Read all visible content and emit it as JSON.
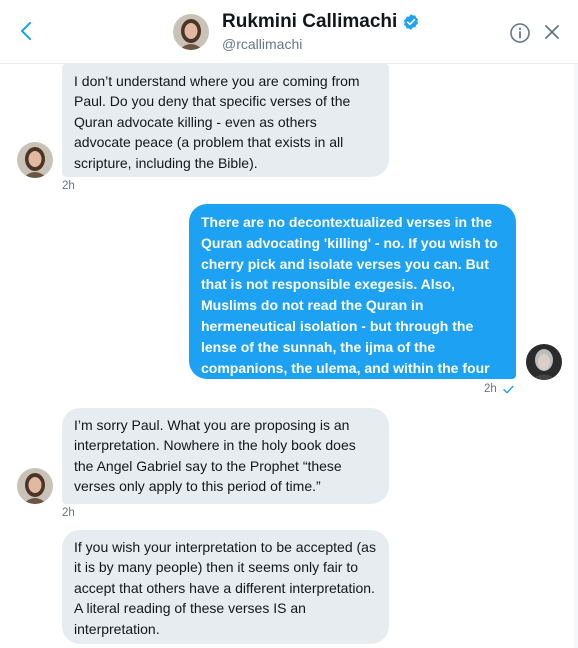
{
  "header": {
    "name": "Rukmini Callimachi",
    "handle": "@rcallimachi"
  },
  "messages": [
    {
      "direction": "incoming",
      "text": "I don’t understand where you are coming from Paul. Do you deny that specific verses of the Quran advocate killing - even as others advocate peace (a problem that exists in all scripture, including the Bible).",
      "time": "2h"
    },
    {
      "direction": "outgoing",
      "text": "There are no decontextualized verses in the Quran advocating 'killing' - no. If you wish to cherry pick and isolate verses you can. But that is not responsible exegesis. Also, Muslims do not read the Quran in hermeneutical isolation - but through the lense of the sunnah, the ijma of the companions, the ulema, and within the four schools.",
      "time": "2h"
    },
    {
      "direction": "incoming",
      "text": "I’m sorry Paul. What you are proposing is an interpretation. Nowhere in the holy book does the Angel Gabriel say to the Prophet “these verses only apply to this period of time.”",
      "time": "2h"
    },
    {
      "direction": "incoming",
      "text": "If you wish your interpretation to be accepted (as it is by many people) then it seems only fair to accept that others have a different interpretation. A literal reading of these verses IS an interpretation.",
      "time": ""
    }
  ],
  "colors": {
    "accent": "#1da1f2",
    "incoming_bubble": "#e6ecf0",
    "muted_text": "#657786"
  },
  "icons": {
    "back": "chevron-left-icon",
    "verified": "verified-badge-icon",
    "info": "info-icon",
    "close": "close-icon",
    "read_receipt": "checkmark-icon"
  }
}
